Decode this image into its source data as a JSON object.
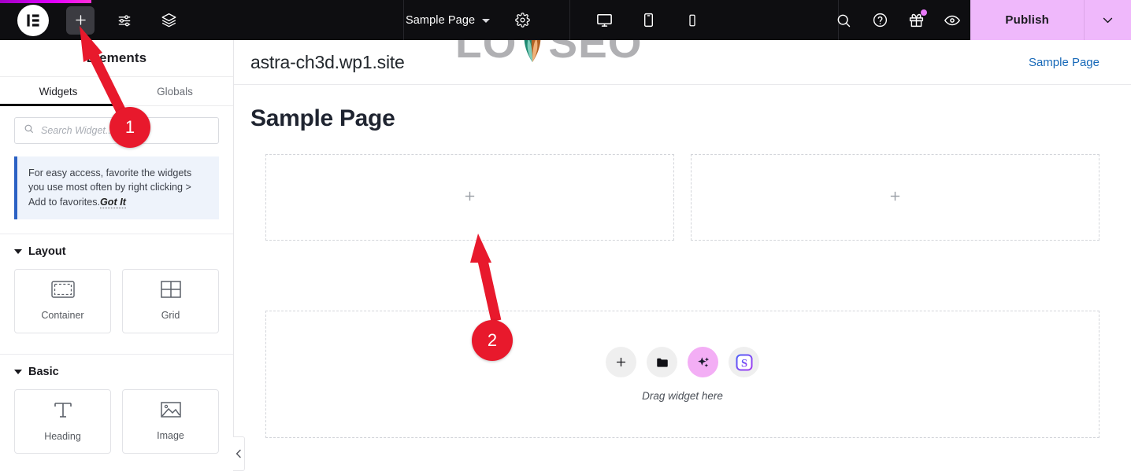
{
  "topbar": {
    "logo_icon": "elementor-logo-icon",
    "add_icon": "plus-icon",
    "settings_sliders_icon": "sliders-icon",
    "layers_icon": "layers-icon",
    "page_name": "Sample Page",
    "page_dropdown_icon": "chevron-down-icon",
    "gear_icon": "gear-icon",
    "devices": [
      {
        "name": "desktop-view-button",
        "icon": "desktop-icon"
      },
      {
        "name": "tablet-view-button",
        "icon": "tablet-icon"
      },
      {
        "name": "mobile-view-button",
        "icon": "mobile-icon"
      }
    ],
    "search_icon": "search-icon",
    "help_icon": "question-circle-icon",
    "gift_icon": "gift-icon",
    "preview_icon": "eye-icon",
    "publish_label": "Publish",
    "publish_dropdown_icon": "chevron-down-icon",
    "publish_color": "#efb8fb",
    "loading_bar_color": "#e200ff"
  },
  "watermark": {
    "text_before": "LO",
    "text_after": "SEO"
  },
  "panel": {
    "title": "Elements",
    "tabs": [
      {
        "label": "Widgets",
        "active": true
      },
      {
        "label": "Globals",
        "active": false
      }
    ],
    "search": {
      "placeholder": "Search Widget...",
      "value": "",
      "icon": "search-icon"
    },
    "notice": {
      "text": "For easy access, favorite the widgets you use most often by right clicking > Add to favorites.",
      "link": "Got It",
      "accent_color": "#2b61c4"
    },
    "sections": [
      {
        "title": "Layout",
        "widgets": [
          {
            "label": "Container",
            "icon": "container-icon"
          },
          {
            "label": "Grid",
            "icon": "grid-icon"
          }
        ]
      },
      {
        "title": "Basic",
        "widgets": [
          {
            "label": "Heading",
            "icon": "heading-text-icon"
          },
          {
            "label": "Image",
            "icon": "image-icon"
          }
        ]
      }
    ],
    "collapse_icon": "chevron-left-icon"
  },
  "canvas": {
    "site_title": "astra-ch3d.wp1.site",
    "site_nav_link": "Sample Page",
    "page_title": "Sample Page",
    "containers": [
      {
        "add_icon": "plus-icon"
      },
      {
        "add_icon": "plus-icon"
      }
    ],
    "dropzone": {
      "label": "Drag widget here",
      "buttons": [
        {
          "name": "add-element-button",
          "icon": "plus-icon"
        },
        {
          "name": "add-template-button",
          "icon": "folder-icon"
        },
        {
          "name": "ai-button",
          "icon": "sparkles-icon"
        },
        {
          "name": "s-badge-button",
          "icon": "s-square-icon"
        }
      ]
    }
  },
  "annotations": [
    {
      "label": "1",
      "color": "#e8192c"
    },
    {
      "label": "2",
      "color": "#e8192c"
    }
  ]
}
